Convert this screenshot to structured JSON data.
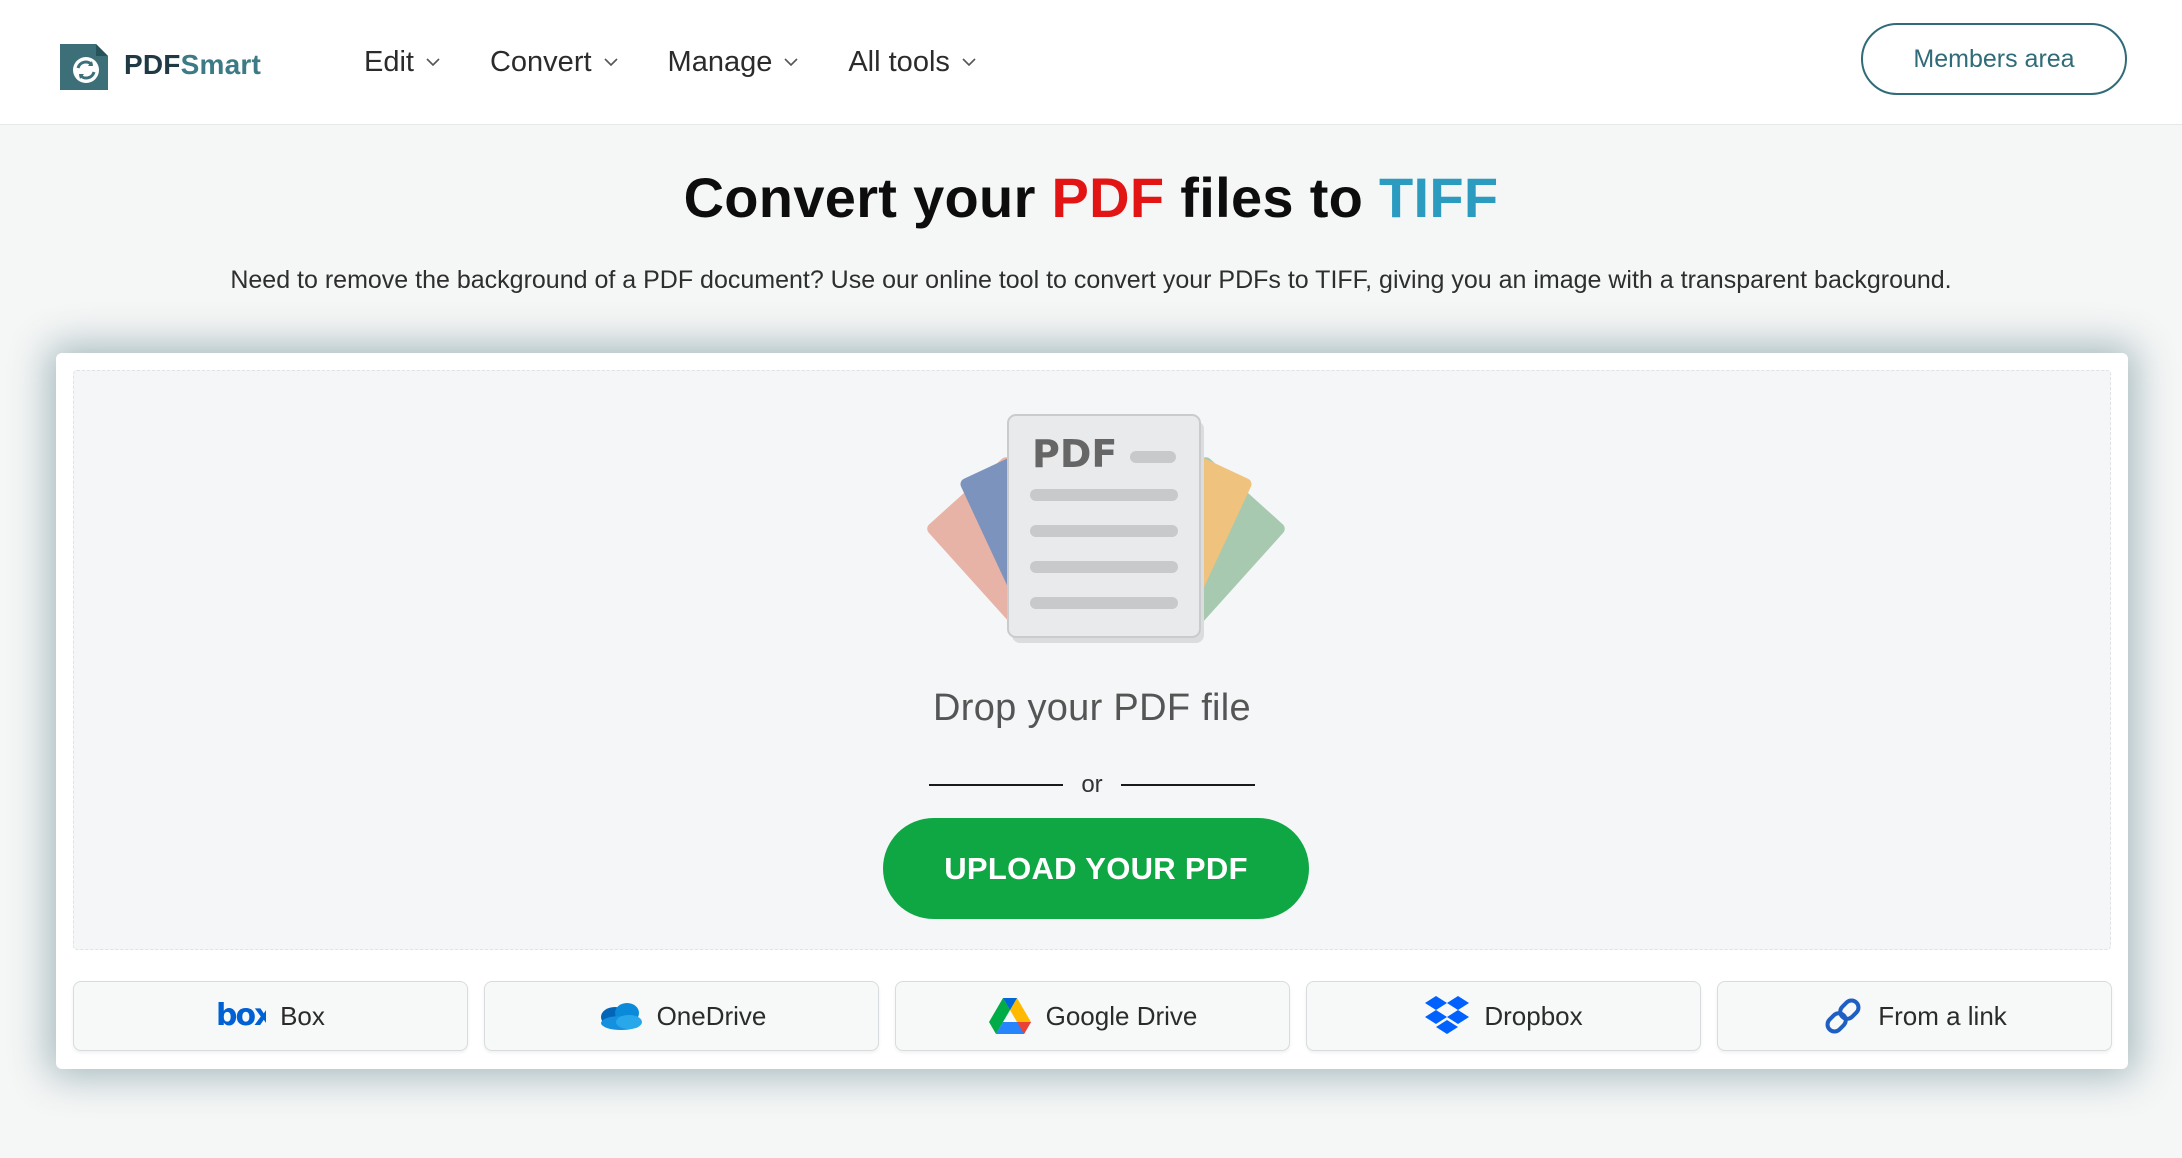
{
  "header": {
    "logo_text_pdf": "PDF",
    "logo_text_smart": "Smart",
    "nav": [
      {
        "label": "Edit"
      },
      {
        "label": "Convert"
      },
      {
        "label": "Manage"
      },
      {
        "label": "All tools"
      }
    ],
    "members_label": "Members area"
  },
  "hero": {
    "title_part1": "Convert your ",
    "title_pdf": "PDF",
    "title_part2": " files to ",
    "title_tiff": "TIFF",
    "subtitle": "Need to remove the background of a PDF document? Use our online tool to convert your PDFs to TIFF, giving you an image with a transparent background."
  },
  "upload": {
    "illustration_label": "PDF",
    "drop_text": "Drop your PDF file",
    "or_text": "or",
    "button_label": "UPLOAD YOUR PDF"
  },
  "sources": [
    {
      "label": "Box",
      "icon": "box-icon",
      "icon_text": "box"
    },
    {
      "label": "OneDrive",
      "icon": "onedrive-icon"
    },
    {
      "label": "Google Drive",
      "icon": "google-drive-icon"
    },
    {
      "label": "Dropbox",
      "icon": "dropbox-icon"
    },
    {
      "label": "From a link",
      "icon": "link-icon"
    }
  ],
  "colors": {
    "accent_red": "#e31414",
    "accent_blue": "#2b9cc0",
    "upload_green": "#0fa644",
    "brand_teal": "#2f6b78"
  }
}
